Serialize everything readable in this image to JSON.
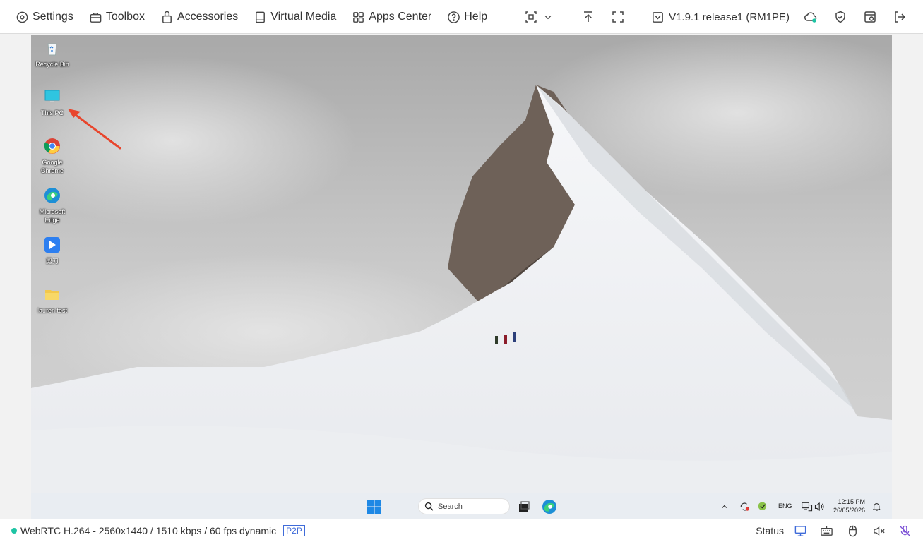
{
  "menu": {
    "settings": "Settings",
    "toolbox": "Toolbox",
    "accessories": "Accessories",
    "virtual_media": "Virtual Media",
    "apps_center": "Apps Center",
    "help": "Help"
  },
  "toolbar": {
    "version": "V1.9.1 release1 (RM1PE)"
  },
  "desktop": {
    "icons": [
      {
        "label": "Recycle Bin"
      },
      {
        "label": "This PC"
      },
      {
        "label": "Google Chrome"
      },
      {
        "label": "Microsoft Edge"
      },
      {
        "label": "剪刀"
      },
      {
        "label": "lauren test"
      }
    ]
  },
  "taskbar": {
    "search_placeholder": "Search",
    "lang": "ENG",
    "time": "12:15 PM",
    "date": "26/05/2026"
  },
  "statusbar": {
    "stream_info": "WebRTC H.264 - 2560x1440 / 1510 kbps / 60 fps dynamic",
    "p2p": "P2P",
    "status_label": "Status"
  },
  "colors": {
    "accent": "#3f6bd9",
    "online": "#1ec4a4",
    "arrow": "#e8452c"
  }
}
